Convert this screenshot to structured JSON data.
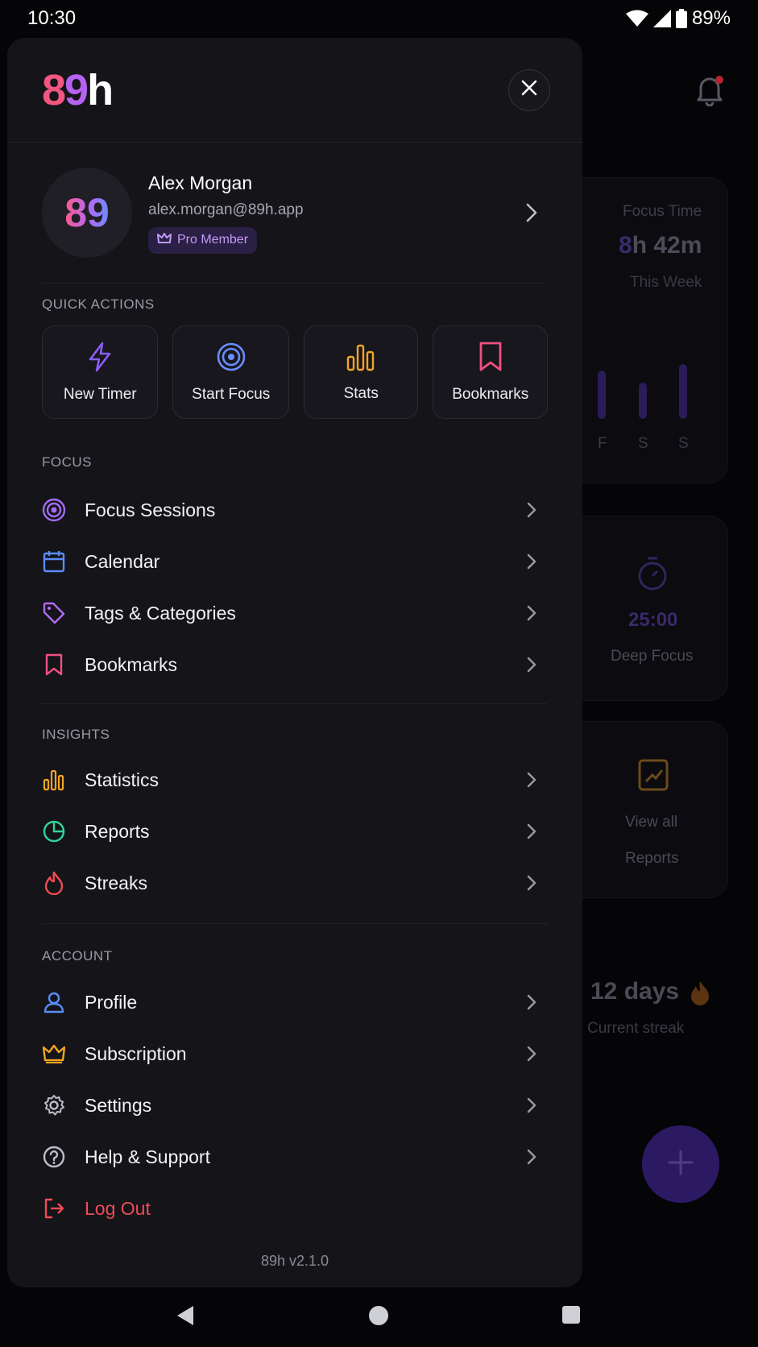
{
  "status": {
    "time": "10:30",
    "battery": "89%"
  },
  "background": {
    "focus_time_label": "Focus Time",
    "focus_time_value_prefix": "8",
    "focus_time_value_rest": "h 42m",
    "week_label": "This Week",
    "days": [
      "F",
      "S",
      "S"
    ],
    "timer_value": "25:00",
    "timer_label": "Deep Focus",
    "view_all_line1": "View all",
    "view_all_line2": "Reports",
    "streak_value": "12 days",
    "streak_label": "Current streak"
  },
  "drawer": {
    "logo": {
      "c1": "8",
      "c2": "9",
      "c3": "h"
    },
    "profile": {
      "avatar_text": "89",
      "name": "Alex Morgan",
      "email": "alex.morgan@89h.app",
      "badge": "Pro Member"
    },
    "quick_actions_title": "QUICK ACTIONS",
    "quick_actions": [
      {
        "label": "New Timer",
        "icon": "bolt-icon"
      },
      {
        "label": "Start Focus",
        "icon": "target-icon"
      },
      {
        "label": "Stats",
        "icon": "bar-chart-icon"
      },
      {
        "label": "Bookmarks",
        "icon": "bookmark-icon"
      }
    ],
    "focus_title": "FOCUS",
    "focus_items": [
      {
        "label": "Focus Sessions",
        "icon": "target-icon"
      },
      {
        "label": "Calendar",
        "icon": "calendar-icon"
      },
      {
        "label": "Tags & Categories",
        "icon": "tag-icon"
      },
      {
        "label": "Bookmarks",
        "icon": "bookmark-icon"
      }
    ],
    "insights_title": "INSIGHTS",
    "insights_items": [
      {
        "label": "Statistics",
        "icon": "bar-chart-icon"
      },
      {
        "label": "Reports",
        "icon": "pie-chart-icon"
      },
      {
        "label": "Streaks",
        "icon": "flame-icon"
      }
    ],
    "account_title": "ACCOUNT",
    "account_items": [
      {
        "label": "Profile",
        "icon": "user-icon"
      },
      {
        "label": "Subscription",
        "icon": "crown-icon"
      },
      {
        "label": "Settings",
        "icon": "gear-icon"
      },
      {
        "label": "Help & Support",
        "icon": "help-icon"
      }
    ],
    "logout_label": "Log Out",
    "version": "89h v2.1.0"
  },
  "colors": {
    "accent_purple": "#8b5cf6",
    "accent_blue": "#6b8cff",
    "accent_orange": "#f5a524",
    "accent_pink": "#f0507f",
    "accent_green": "#34d399",
    "accent_red": "#ef4b55"
  }
}
